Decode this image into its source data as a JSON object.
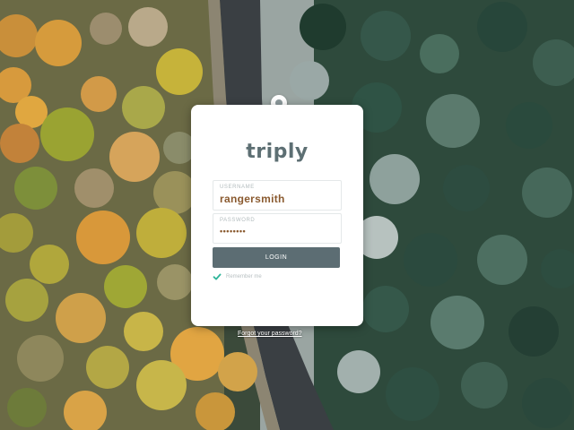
{
  "brand": {
    "logo_text": "triply"
  },
  "login_form": {
    "username": {
      "label": "USERNAME",
      "value": "rangersmith"
    },
    "password": {
      "label": "PASSWORD",
      "value": "••••••••"
    },
    "submit_label": "LOGIN",
    "remember_me": {
      "label": "Remember me",
      "checked": true
    }
  },
  "forgot_password_link": "Forgot your password?",
  "colors": {
    "accent": "#5c6d73",
    "input_text": "#8a5a2f",
    "check": "#2fb59a"
  },
  "icons": {
    "remember_check": "checkmark-icon"
  }
}
